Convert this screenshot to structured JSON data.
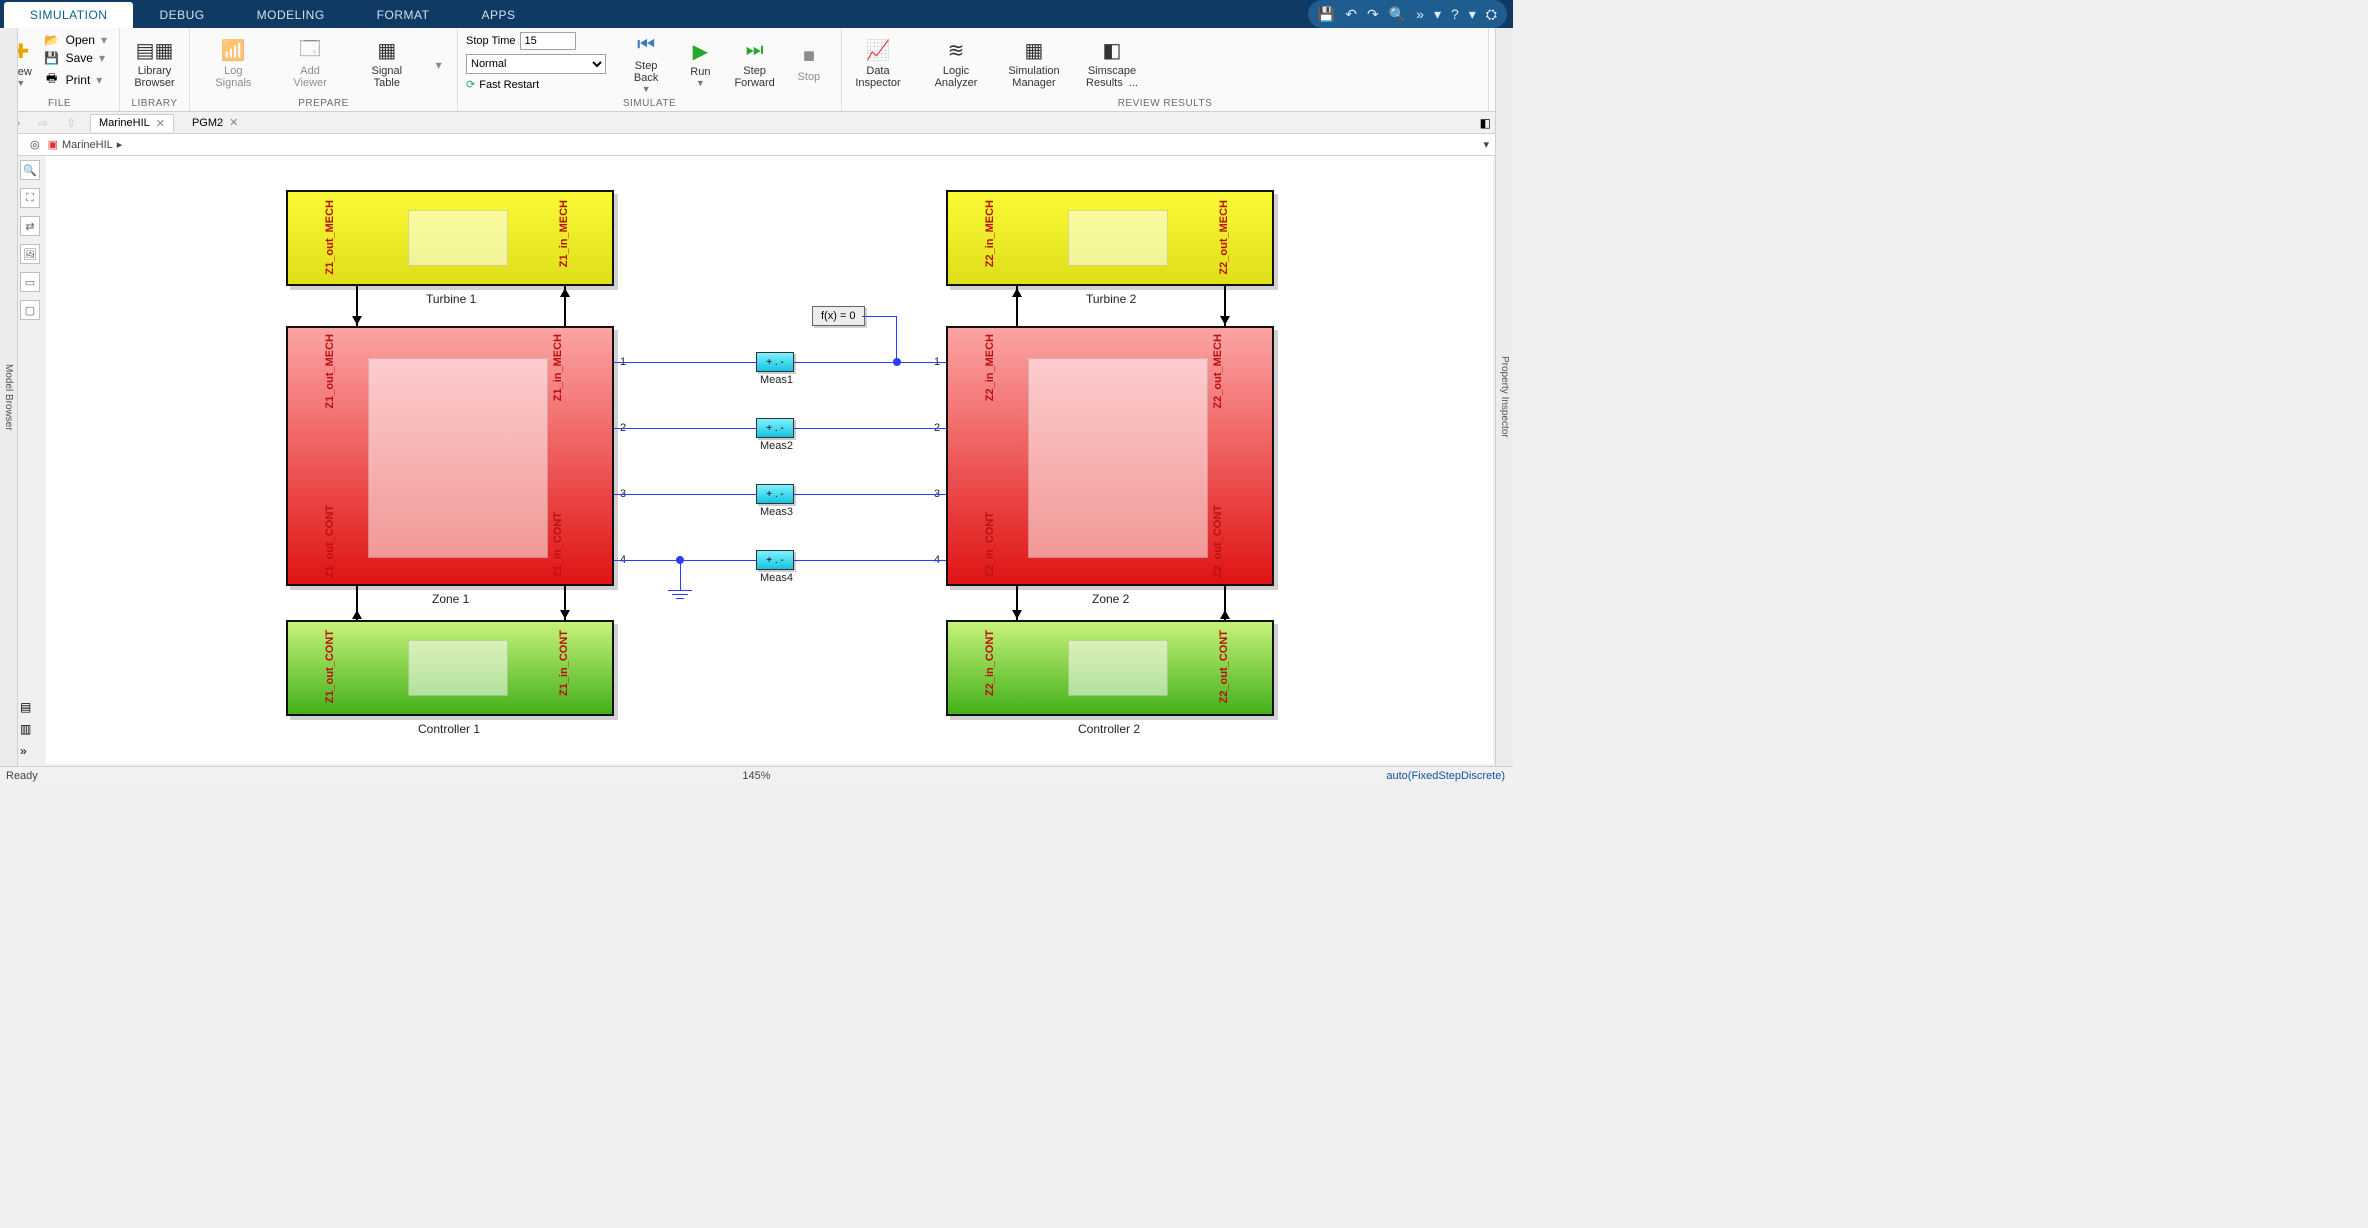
{
  "tabs": {
    "simulation": "SIMULATION",
    "debug": "DEBUG",
    "modeling": "MODELING",
    "format": "FORMAT",
    "apps": "APPS"
  },
  "ribbon": {
    "groups": {
      "file": "FILE",
      "library": "LIBRARY",
      "prepare": "PREPARE",
      "simulate": "SIMULATE",
      "review": "REVIEW RESULTS"
    },
    "file": {
      "new": "New",
      "open": "Open",
      "save": "Save",
      "print": "Print"
    },
    "library": {
      "browser": "Library\nBrowser"
    },
    "prepare": {
      "log": "Log\nSignals",
      "viewer": "Add\nViewer",
      "signal_table": "Signal\nTable"
    },
    "simulate": {
      "stop_label": "Stop Time",
      "stop_value": "15",
      "mode": "Normal",
      "fast_restart": "Fast Restart",
      "step_back": "Step\nBack",
      "run": "Run",
      "step_forward": "Step\nForward",
      "stop": "Stop"
    },
    "review": {
      "data_inspector": "Data\nInspector",
      "logic_analyzer": "Logic\nAnalyzer",
      "sim_manager": "Simulation\nManager",
      "simscape": "Simscape\nResults  ..."
    }
  },
  "doctabs": {
    "t1": "MarineHIL",
    "t2": "PGM2"
  },
  "crumb": {
    "root": "MarineHIL"
  },
  "sidebars": {
    "left": "Model Browser",
    "right": "Property Inspector"
  },
  "blocks": {
    "turbine1": "Turbine 1",
    "turbine2": "Turbine 2",
    "zone1": "Zone 1",
    "zone2": "Zone 2",
    "ctrl1": "Controller 1",
    "ctrl2": "Controller 2",
    "solver": "f(x) = 0",
    "z1_out_mech": "Z1_out_MECH",
    "z1_in_mech": "Z1_in_MECH",
    "z1_out_cont": "Z1_out_CONT",
    "z1_in_cont": "Z1_in_CONT",
    "z2_in_mech": "Z2_in_MECH",
    "z2_out_mech": "Z2_out_MECH",
    "z2_in_cont": "Z2_in_CONT",
    "z2_out_cont": "Z2_out_CONT",
    "meas1": "Meas1",
    "meas2": "Meas2",
    "meas3": "Meas3",
    "meas4": "Meas4",
    "p1": "1",
    "p2": "2",
    "p3": "3",
    "p4": "4"
  },
  "status": {
    "ready": "Ready",
    "zoom": "145%",
    "solver": "auto(FixedStepDiscrete)"
  }
}
